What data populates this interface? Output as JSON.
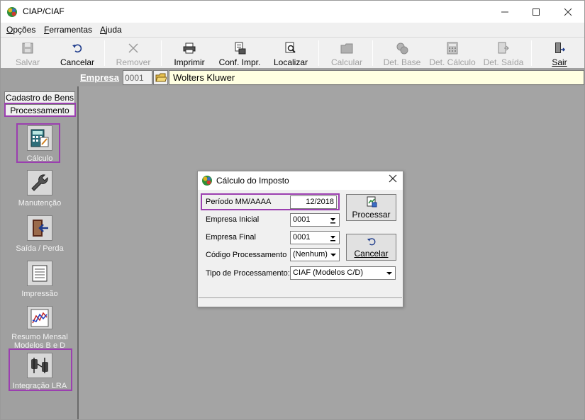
{
  "window": {
    "title": "CIAP/CIAF"
  },
  "menu": [
    {
      "label_ul": "O",
      "label_rest": "pções"
    },
    {
      "label_ul": "F",
      "label_rest": "erramentas"
    },
    {
      "label_ul": "A",
      "label_rest": "juda"
    }
  ],
  "toolbar": {
    "salvar": "Salvar",
    "cancelar": "Cancelar",
    "remover": "Remover",
    "imprimir": "Imprimir",
    "conf_impr": "Conf. Impr.",
    "localizar": "Localizar",
    "calcular": "Calcular",
    "det_base": "Det. Base",
    "det_calculo": "Det. Cálculo",
    "det_saida": "Det. Saída",
    "sair": "Sair"
  },
  "empresa": {
    "label": "Empresa",
    "code": "0001",
    "name": "Wolters Kluwer"
  },
  "sidebar": {
    "tabs": [
      "Cadastro de Bens",
      "Processamento"
    ],
    "items": [
      {
        "label": "Cálculo"
      },
      {
        "label": "Manutenção"
      },
      {
        "label": "Saída / Perda"
      },
      {
        "label": "Impressão"
      },
      {
        "label": "Resumo Mensal Modelos B e D"
      },
      {
        "label": "Integração LRA"
      }
    ]
  },
  "dialog": {
    "title": "Cálculo do Imposto",
    "periodo_label": "Período  MM/AAAA",
    "periodo_value": "12/2018",
    "empresa_inicial_label": "Empresa Inicial",
    "empresa_inicial_value": "0001",
    "empresa_final_label": "Empresa Final",
    "empresa_final_value": "0001",
    "codigo_label": "Código Processamento",
    "codigo_value": "(Nenhum)",
    "tipo_label": "Tipo de Processamento:",
    "tipo_value": "CIAF (Modelos C/D)",
    "processar": "Processar",
    "cancelar": "Cancelar"
  },
  "colors": {
    "highlight": "#9b3fb0",
    "workspace": "#a4a4a4",
    "empresa_name_bg": "#ffffe1"
  }
}
